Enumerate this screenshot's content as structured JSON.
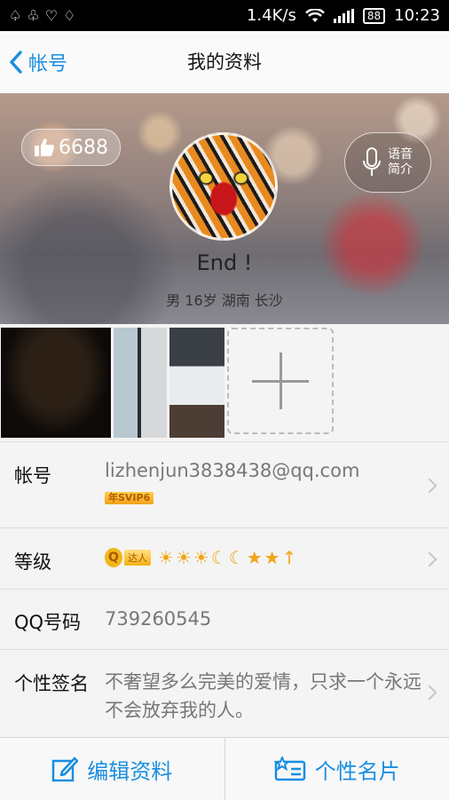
{
  "status": {
    "speed": "1.4K/s",
    "battery": "88",
    "time": "10:23",
    "suits": [
      "♤",
      "♧",
      "♡",
      "♢"
    ]
  },
  "nav": {
    "back_label": "帐号",
    "title": "我的资料"
  },
  "profile": {
    "likes": "6688",
    "voice_line1": "语音",
    "voice_line2": "简介",
    "nickname": "End !",
    "meta": "男 16岁 湖南 长沙"
  },
  "rows": {
    "account": {
      "label": "帐号",
      "value": "lizhenjun3838438@qq.com",
      "badge": "年SVIP6"
    },
    "level": {
      "label": "等级",
      "badge": "达人",
      "icons": [
        "☀",
        "☀",
        "☀",
        "☾",
        "☾",
        "★",
        "★",
        "↑"
      ]
    },
    "qq": {
      "label": "QQ号码",
      "value": "739260545"
    },
    "signature": {
      "label": "个性签名",
      "value": "不奢望多么完美的爱情，只求一个永远不会放弃我的人。"
    }
  },
  "bottom": {
    "edit_label": "编辑资料",
    "card_label": "个性名片"
  },
  "colors": {
    "accent": "#1a8ee1"
  }
}
